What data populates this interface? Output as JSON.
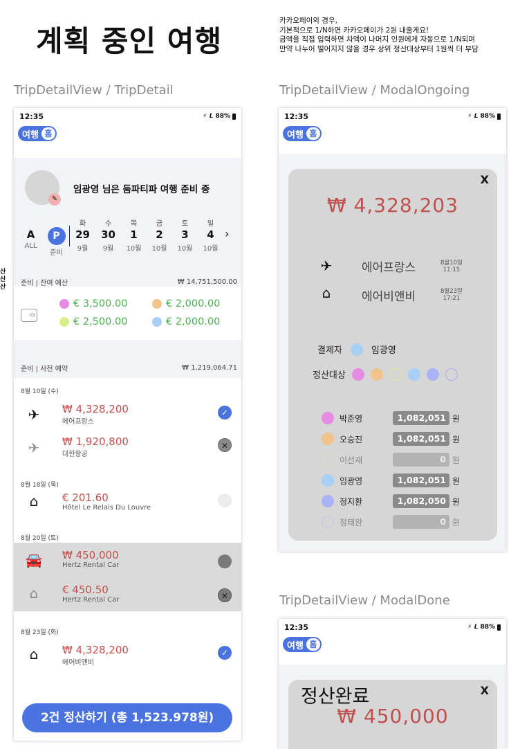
{
  "page_title": "계획 중인 여행",
  "notes": [
    "카카오페이의 경우,",
    "기본적으로 1/N하면 카카오페이가 2원 내줄게요!",
    "금액을 직접 입력하면 차액이 나머지 인원에게 자동으로 1/N되며",
    "만약 나누어 떨어지지 않을 경우 상위 정산대상부터 1원씩 더 부담"
  ],
  "side_mark": [
    "산",
    "산",
    "산"
  ],
  "frames": {
    "detail": "TripDetailView / TripDetail",
    "ongoing": "TripDetailView / ModalOngoing",
    "done": "TripDetailView / ModalDone"
  },
  "status_bar": {
    "time": "12:35",
    "battery": "88%",
    "icons": "⚡ 𝙇"
  },
  "toggle": {
    "label": "여행",
    "knob": "홈"
  },
  "colors": {
    "accent": "#4a73e0",
    "amount_red": "#c0504d",
    "budget_green": "#4caf50"
  },
  "detail": {
    "greeting": "임광영 님은  둠파티파 여행 준비 중",
    "all": {
      "letter": "A",
      "label": "ALL"
    },
    "prep": {
      "letter": "P",
      "label": "준비"
    },
    "days": [
      {
        "dow": "화",
        "num": "29",
        "mon": "9월"
      },
      {
        "dow": "수",
        "num": "30",
        "mon": "9월"
      },
      {
        "dow": "목",
        "num": "1",
        "mon": "10월"
      },
      {
        "dow": "금",
        "num": "2",
        "mon": "10월"
      },
      {
        "dow": "토",
        "num": "3",
        "mon": "10월"
      },
      {
        "dow": "일",
        "num": "4",
        "mon": "10월"
      }
    ],
    "budget": {
      "label": "준비 | 잔여 예산",
      "total": "₩ 14,751,500.00",
      "items": [
        {
          "amount": "€ 3,500.00",
          "color": "#e58be0"
        },
        {
          "amount": "€ 2,000.00",
          "color": "#f0c48a"
        },
        {
          "amount": "€ 2,500.00",
          "color": "#d9f08a"
        },
        {
          "amount": "€ 2,000.00",
          "color": "#a8cff5"
        }
      ]
    },
    "bookings": {
      "label": "준비  |  사전 예약",
      "total": "₩ 1,219,064.71",
      "groups": [
        {
          "date": "8월 10일 (수)",
          "items": [
            {
              "icon": "airplane-icon",
              "amount": "₩ 4,328,200",
              "name": "에어프랑스",
              "state": "checked"
            },
            {
              "icon": "airplane-icon",
              "amount": "₩ 1,920,800",
              "name": "대한항공",
              "state": "x"
            }
          ]
        },
        {
          "date": "8월 18일 (목)",
          "items": [
            {
              "icon": "house-icon",
              "amount": "€ 201.60",
              "name": "Hôtel Le Relais Du Louvre",
              "state": "empty"
            }
          ]
        },
        {
          "date": "8월 20일 (토)",
          "items": [
            {
              "icon": "car-icon",
              "amount": "₩ 450,000",
              "name": "Hertz Rental Car",
              "state": "filled"
            },
            {
              "icon": "house-icon",
              "amount": "€ 450.50",
              "name": "Hertz Rental Car",
              "state": "x"
            }
          ]
        },
        {
          "date": "8월 23일 (화)",
          "items": [
            {
              "icon": "house-icon",
              "amount": "₩ 4,328,200",
              "name": "에어비앤비",
              "state": "checked"
            }
          ]
        }
      ]
    },
    "settle_button": "2건 정산하기 (총 1,523.978원)"
  },
  "ongoing": {
    "close": "X",
    "amount": "₩ 4,328,203",
    "places": [
      {
        "icon": "airplane-icon",
        "name": "에어프랑스",
        "date": "8월10일",
        "time": "11:15"
      },
      {
        "icon": "house-icon",
        "name": "에어비앤비",
        "date": "8월23일",
        "time": "17:21"
      }
    ],
    "payer_label": "결제자",
    "payer_name": "임광영",
    "payer_color": "#a8cff5",
    "targets_label": "정산대상",
    "target_colors": [
      "#e58be0",
      "#f0c48a",
      "#d9f08a",
      "#a8cff5",
      "#a9b3f5",
      "#b4a9f5"
    ],
    "people": [
      {
        "name": "박준영",
        "amount": "1,082,051",
        "unit": "원",
        "color": "#e58be0",
        "active": true
      },
      {
        "name": "오승진",
        "amount": "1,082,051",
        "unit": "원",
        "color": "#f0c48a",
        "active": true
      },
      {
        "name": "이선재",
        "amount": "0",
        "unit": "원",
        "color": "#d9f08a",
        "active": false
      },
      {
        "name": "임광영",
        "amount": "1,082,051",
        "unit": "원",
        "color": "#a8cff5",
        "active": true
      },
      {
        "name": "정지환",
        "amount": "1,082,050",
        "unit": "원",
        "color": "#a9b3f5",
        "active": true
      },
      {
        "name": "정태완",
        "amount": "0",
        "unit": "원",
        "color": "#b4a9f5",
        "active": false
      }
    ]
  },
  "done": {
    "title": "정산완료",
    "close": "X",
    "amount": "₩ 450,000"
  }
}
